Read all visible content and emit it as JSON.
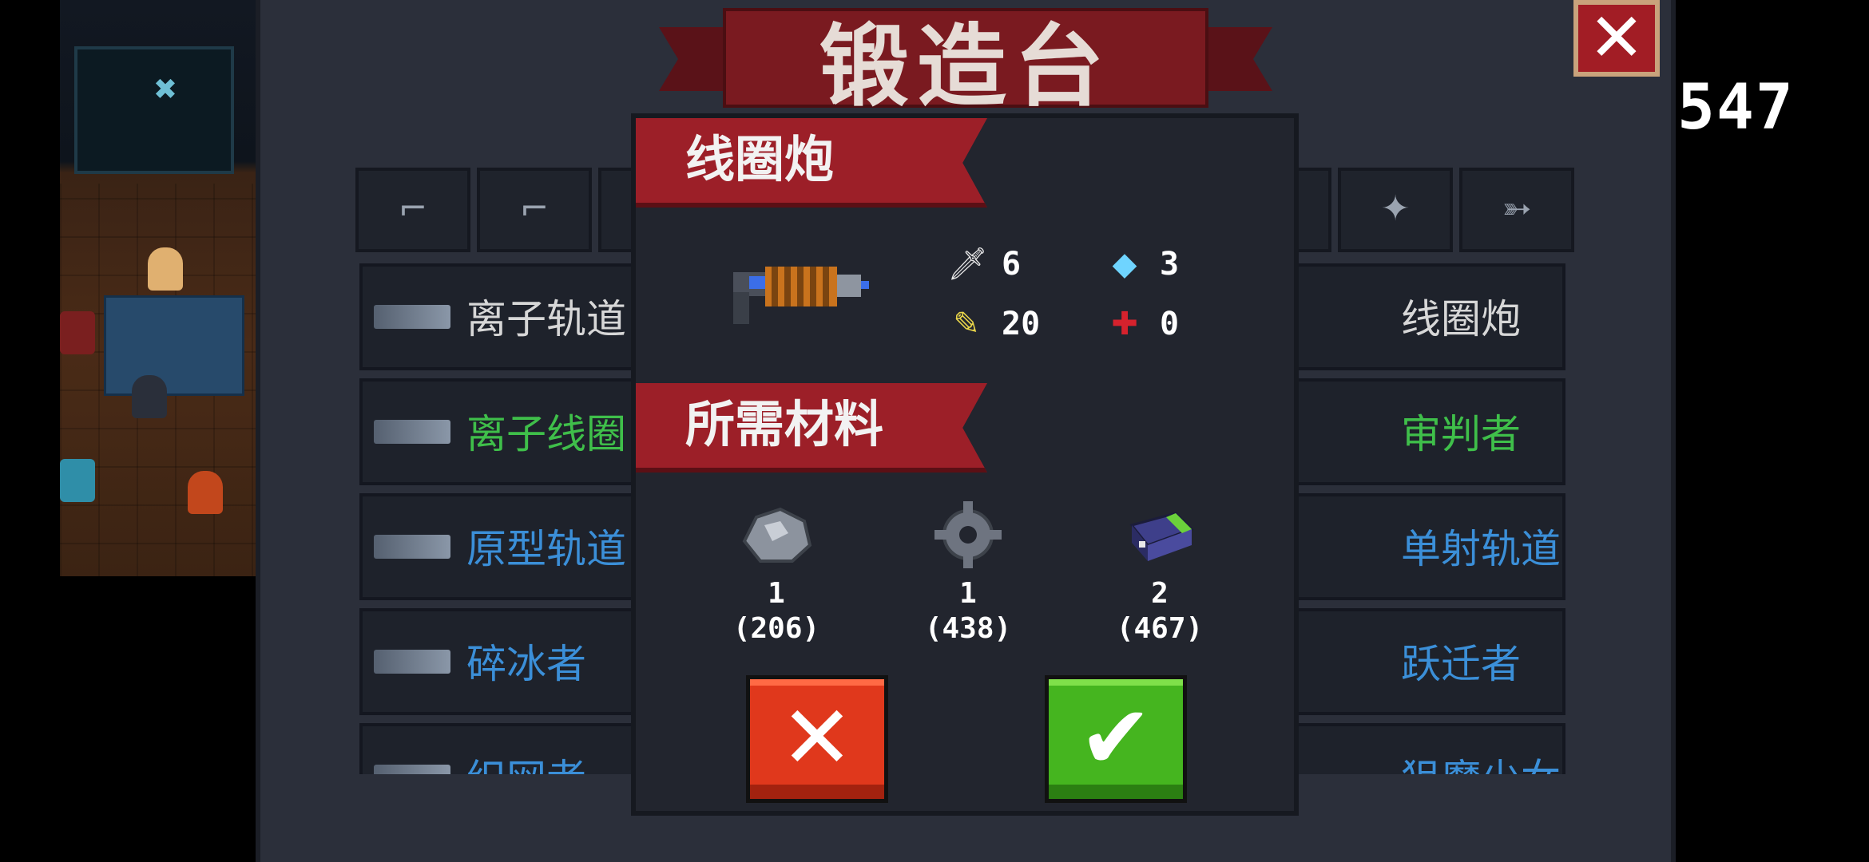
{
  "hud": {
    "counter": "547"
  },
  "forge": {
    "title": "锻造台",
    "close_label": "✕",
    "tabs": [
      "⌐",
      "⌐",
      "⌐",
      "⌐",
      "✦",
      "➳"
    ],
    "list_left": [
      {
        "name": "离子轨道",
        "color": "#d7d7d7"
      },
      {
        "name": "离子线圈",
        "color": "#3fbf4a"
      },
      {
        "name": "原型轨道",
        "color": "#3b8fd8"
      },
      {
        "name": "碎冰者",
        "color": "#3b8fd8"
      },
      {
        "name": "织网者",
        "color": "#3b8fd8"
      }
    ],
    "list_right": [
      {
        "name": "线圈炮",
        "color": "#d7d7d7"
      },
      {
        "name": "审判者",
        "color": "#3fbf4a"
      },
      {
        "name": "单射轨道炮",
        "color": "#3b8fd8"
      },
      {
        "name": "跃迁者",
        "color": "#3b8fd8"
      },
      {
        "name": "狙魔少女",
        "color": "#3b8fd8"
      }
    ]
  },
  "modal": {
    "weapon_name": "线圈炮",
    "stats": [
      {
        "icon": "sword-icon",
        "glyph": "🗡",
        "value": "6",
        "color": "#e8e8e8"
      },
      {
        "icon": "diamond-icon",
        "glyph": "◆",
        "value": "3",
        "color": "#6fd4ff"
      },
      {
        "icon": "bullet-icon",
        "glyph": "✎",
        "value": "20",
        "color": "#e8d44a"
      },
      {
        "icon": "crosshair-icon",
        "glyph": "✚",
        "value": "0",
        "color": "#d6222d"
      }
    ],
    "materials_title": "所需材料",
    "materials": [
      {
        "icon": "ore-icon",
        "need": "1",
        "have": "(206)"
      },
      {
        "icon": "gear-icon",
        "need": "1",
        "have": "(438)"
      },
      {
        "icon": "battery-icon",
        "need": "2",
        "have": "(467)"
      }
    ],
    "cancel_label": "✕",
    "confirm_label": "✔"
  }
}
